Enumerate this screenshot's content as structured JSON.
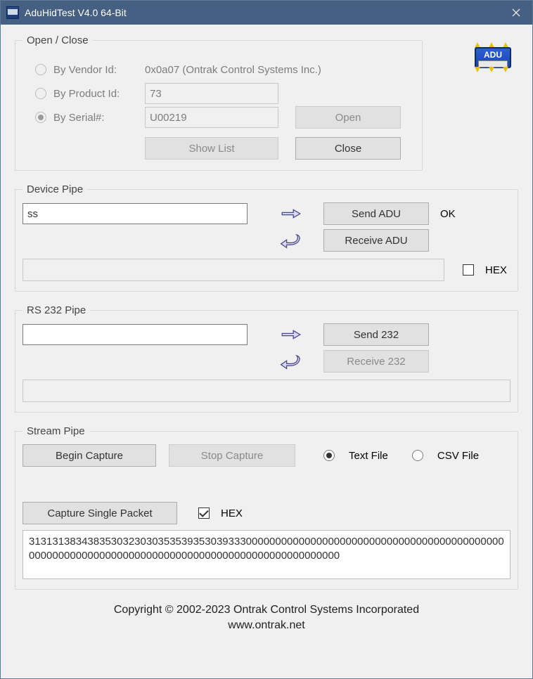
{
  "window": {
    "title": "AduHidTest V4.0 64-Bit"
  },
  "open_close": {
    "legend": "Open / Close",
    "by_vendor_label": "By Vendor Id:",
    "vendor_text": "0x0a07 (Ontrak Control Systems Inc.)",
    "by_product_label": "By Product Id:",
    "product_value": "73",
    "by_serial_label": "By Serial#:",
    "serial_value": "U00219",
    "show_list_label": "Show List",
    "open_label": "Open",
    "close_label": "Close",
    "adu_chip_label": "ADU"
  },
  "device_pipe": {
    "legend": "Device Pipe",
    "send_input_value": "ss",
    "send_label": "Send ADU",
    "send_status": "OK",
    "receive_label": "Receive ADU",
    "receive_value": "",
    "hex_label": "HEX"
  },
  "rs232_pipe": {
    "legend": "RS 232 Pipe",
    "send_input_value": "",
    "send_label": "Send 232",
    "receive_label": "Receive 232",
    "receive_value": ""
  },
  "stream_pipe": {
    "legend": "Stream Pipe",
    "begin_label": "Begin Capture",
    "stop_label": "Stop Capture",
    "text_file_label": "Text File",
    "csv_file_label": "CSV File",
    "capture_single_label": "Capture Single Packet",
    "hex_label": "HEX",
    "capture_value": "31313138343835303230303535393530393330000000000000000000000000000000000000000000000000000000000000000000000000000000000000000000000000"
  },
  "footer": {
    "line1": "Copyright © 2002-2023 Ontrak Control Systems Incorporated",
    "line2": "www.ontrak.net"
  }
}
